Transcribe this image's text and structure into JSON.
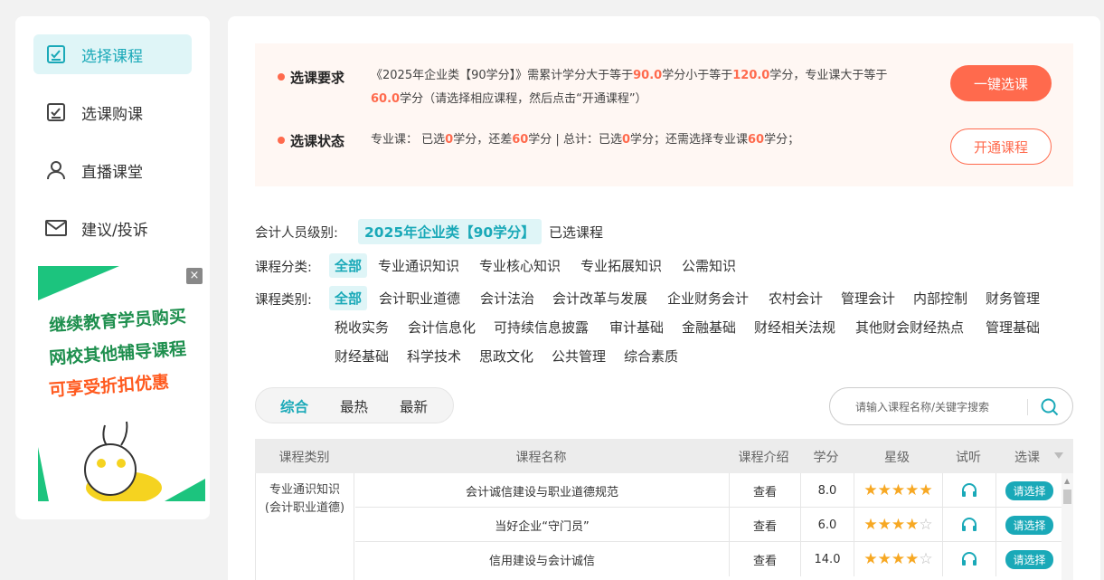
{
  "sidebar": {
    "items": [
      {
        "label": "选择课程",
        "icon": "checkbox-icon",
        "active": true
      },
      {
        "label": "选课购课",
        "icon": "checkbox-icon",
        "active": false
      },
      {
        "label": "直播课堂",
        "icon": "user-icon",
        "active": false
      },
      {
        "label": "建议/投诉",
        "icon": "mail-icon",
        "active": false
      }
    ],
    "promo": {
      "line1": "继续教育学员购买",
      "line2": "网校其他辅导课程",
      "line3": "可享受折扣优惠",
      "close": "×"
    }
  },
  "requirement": {
    "label1": "选课要求",
    "text_a": "《2025年企业类【90学分】》需累计学分大于等于",
    "min_credit": "90.0",
    "text_b": "学分小于等于",
    "max_credit": "120.0",
    "text_c": "学分，专业课大于等于",
    "prof_credit": "60.0",
    "text_d": "学分（请选择相应课程，然后点击“开通课程”）",
    "label2": "选课状态",
    "s1": "专业课： 已选",
    "s_sel": "0",
    "s2": "学分，还差",
    "s_need": "60",
    "s3": "学分 | 总计：已选",
    "s_total": "0",
    "s4": "学分；还需选择专业课",
    "s_need2": "60",
    "s5": "学分；",
    "btn_one_click": "一键选课",
    "btn_open": "开通课程"
  },
  "filters": {
    "level_label": "会计人员级别:",
    "level_selected": "2025年企业类【90学分】",
    "level_other": "已选课程",
    "category_label": "课程分类:",
    "categories": [
      "全部",
      "专业通识知识",
      "专业核心知识",
      "专业拓展知识",
      "公需知识"
    ],
    "type_label": "课程类别:",
    "types_row1": [
      "全部",
      "会计职业道德",
      "会计法治",
      "会计改革与发展",
      "企业财务会计",
      "农村会计",
      "管理会计",
      "内部控制",
      "财务管理"
    ],
    "types_row2": [
      "税收实务",
      "会计信息化",
      "可持续信息披露",
      "审计基础",
      "金融基础",
      "财经相关法规",
      "其他财会财经热点",
      "管理基础"
    ],
    "types_row3": [
      "财经基础",
      "科学技术",
      "思政文化",
      "公共管理",
      "综合素质"
    ]
  },
  "tabs": [
    "综合",
    "最热",
    "最新"
  ],
  "search": {
    "placeholder": "请输入课程名称/关键字搜索"
  },
  "table": {
    "headers": [
      "课程类别",
      "课程名称",
      "课程介绍",
      "学分",
      "星级",
      "试听",
      "选课"
    ],
    "category_cell": "专业通识知识\n(会计职业道德)",
    "category_l1": "专业通识知识",
    "category_l2": "(会计职业道德)",
    "rows": [
      {
        "name": "会计诚信建设与职业道德规范",
        "intro": "查看",
        "credit": "8.0",
        "stars": 5,
        "action": "请选择"
      },
      {
        "name": "当好企业“守门员”",
        "intro": "查看",
        "credit": "6.0",
        "stars": 4,
        "action": "请选择"
      },
      {
        "name": "信用建设与会计诚信",
        "intro": "查看",
        "credit": "14.0",
        "stars": 4,
        "action": "请选择"
      }
    ]
  },
  "colors": {
    "accent": "#1aa9b8",
    "orange": "#ff6a4d",
    "star": "#f7a823"
  }
}
